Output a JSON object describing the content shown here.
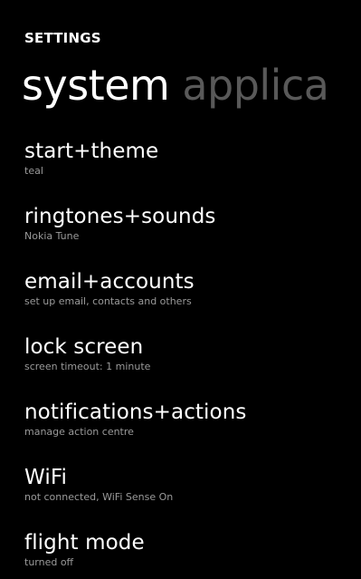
{
  "header": {
    "app_title": "SETTINGS",
    "pivots": [
      "system",
      "applica"
    ]
  },
  "settings": [
    {
      "title": "start+theme",
      "subtitle": "teal"
    },
    {
      "title": "ringtones+sounds",
      "subtitle": "Nokia Tune"
    },
    {
      "title": "email+accounts",
      "subtitle": "set up email, contacts and others"
    },
    {
      "title": "lock screen",
      "subtitle": "screen timeout: 1 minute"
    },
    {
      "title": "notifications+actions",
      "subtitle": "manage action centre"
    },
    {
      "title": "WiFi",
      "subtitle": "not connected, WiFi Sense On"
    },
    {
      "title": "flight mode",
      "subtitle": "turned off"
    }
  ],
  "colors": {
    "background": "#000000",
    "text": "#ffffff",
    "subtext": "#9a9a9a",
    "inactive_pivot": "#595959"
  }
}
